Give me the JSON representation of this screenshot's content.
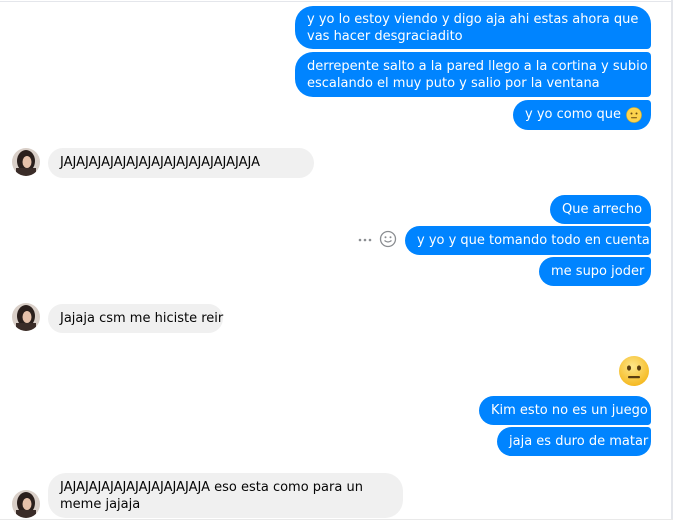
{
  "conversation": {
    "messages": [
      {
        "from": "me",
        "text_line1": "y yo lo estoy viendo y digo aja ahi estas ahora que",
        "text_line2": "vas hacer desgraciadito"
      },
      {
        "from": "me",
        "text_line1": "derrepente salto a la pared llego a la cortina y subio",
        "text_line2": "escalando el muy puto y salio por la ventana"
      },
      {
        "from": "me",
        "text": "y yo como que",
        "emoji": "neutral-face"
      },
      {
        "from": "them",
        "text": "JAJAJAJAJAJAJAJAJAJAJAJAJAJAJAJA"
      },
      {
        "from": "me",
        "text": "Que arrecho"
      },
      {
        "from": "me",
        "text": "y yo y que tomando todo en cuenta"
      },
      {
        "from": "me",
        "text": "me supo joder"
      },
      {
        "from": "them",
        "text": "Jajaja csm me hiciste reir"
      },
      {
        "from": "me",
        "emoji": "neutral-face"
      },
      {
        "from": "me",
        "text": "Kim esto no es un juego"
      },
      {
        "from": "me",
        "text": "jaja es duro de matar"
      },
      {
        "from": "them",
        "text_line1": "JAJAJAJAJAJAJAJAJAJAJAJA eso esta como para un",
        "text_line2": "meme jajaja"
      }
    ]
  },
  "icons": {
    "more": "more-icon",
    "react": "react-smiley-icon",
    "emoji": "neutral-face-emoji"
  },
  "colors": {
    "outgoing_bubble": "#0084ff",
    "incoming_bubble": "#f0f0f0",
    "emoji_yellow": "#fcd34d"
  }
}
